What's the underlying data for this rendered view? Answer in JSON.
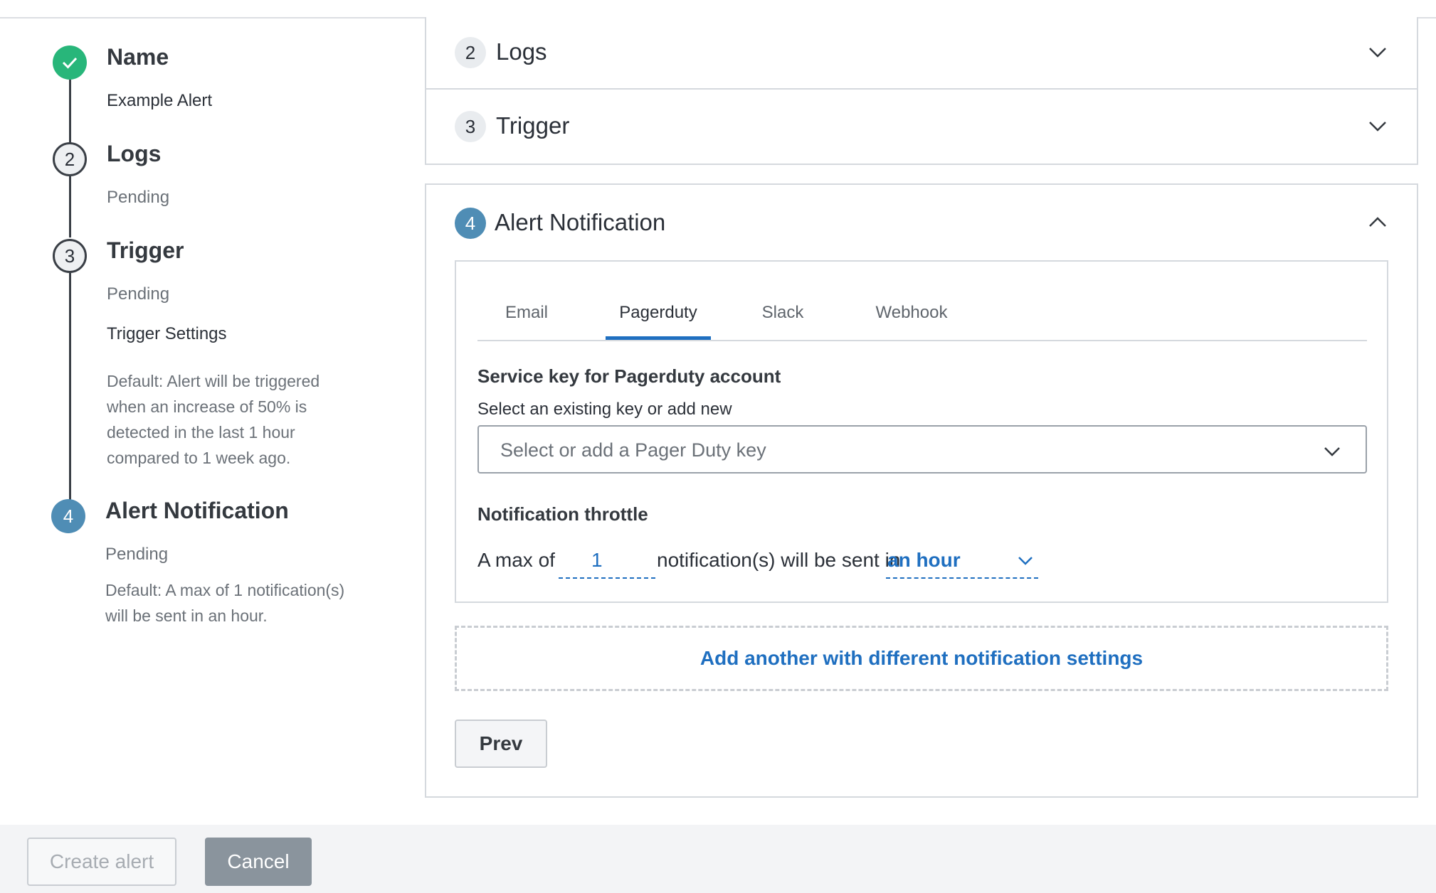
{
  "stepper": {
    "steps": [
      {
        "number": "",
        "title": "Name",
        "status": "Example Alert",
        "state": "done",
        "icon": "check-icon"
      },
      {
        "number": "2",
        "title": "Logs",
        "status": "Pending",
        "state": "pending"
      },
      {
        "number": "3",
        "title": "Trigger",
        "status": "Pending",
        "state": "pending",
        "extra_label": "Trigger Settings",
        "description": "Default: Alert will be triggered\nwhen an increase of 50% is\ndetected in the last 1 hour\ncompared to 1 week ago."
      },
      {
        "number": "4",
        "title": "Alert Notification",
        "status": "Pending",
        "state": "active",
        "description": "Default: A max of 1 notification(s)\nwill be sent in an hour."
      }
    ]
  },
  "accordion": {
    "logs": {
      "number": "2",
      "title": "Logs",
      "expanded": false
    },
    "trigger": {
      "number": "3",
      "title": "Trigger",
      "expanded": false
    },
    "alert_notification": {
      "number": "4",
      "title": "Alert Notification",
      "expanded": true
    }
  },
  "notification": {
    "tabs": [
      {
        "label": "Email",
        "active": false
      },
      {
        "label": "Pagerduty",
        "active": true
      },
      {
        "label": "Slack",
        "active": false
      },
      {
        "label": "Webhook",
        "active": false
      }
    ],
    "service_key_label": "Service key for Pagerduty account",
    "select_hint": "Select an existing key or add new",
    "select_placeholder": "Select or add a Pager Duty key",
    "throttle_label": "Notification throttle",
    "throttle_prefix": "A max of",
    "throttle_count": "1",
    "throttle_middle": "notification(s) will be sent in",
    "throttle_period": "an hour",
    "add_another": "Add another with different notification settings",
    "prev_label": "Prev"
  },
  "footer": {
    "create_label": "Create alert",
    "cancel_label": "Cancel"
  },
  "colors": {
    "accent": "#1f6fc0",
    "done": "#28b67a",
    "active_step": "#4f8db5"
  }
}
